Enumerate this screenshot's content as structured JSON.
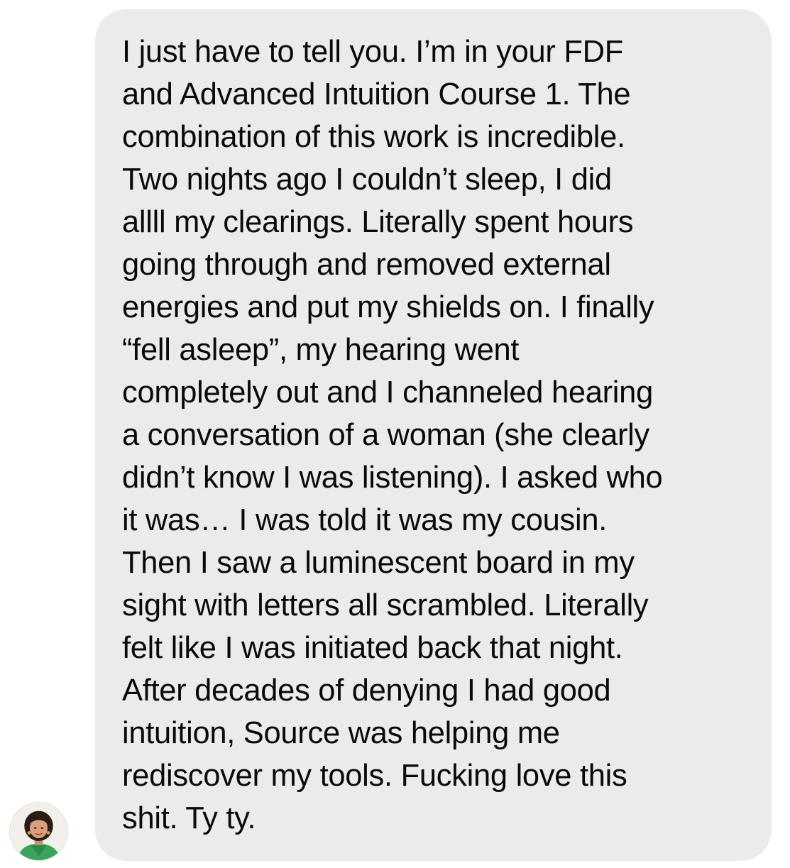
{
  "conversation": {
    "message": {
      "lines": [
        "I just have to tell you. I’m in your FDF",
        "and Advanced Intuition Course 1. The",
        "combination of this work is incredible.",
        "Two nights ago I couldn’t sleep, I did",
        "allll my clearings. Literally spent hours",
        "going through and removed external",
        "energies and put my shields on. I finally",
        "“fell asleep”, my hearing went",
        "completely out and I channeled hearing",
        "a conversation of a woman (she clearly",
        "didn’t know I was listening). I asked who",
        "it was… I was told it was my cousin.",
        "Then I saw a luminescent board in my",
        "sight with letters all scrambled. Literally",
        "felt like I was initiated back that night.",
        "After decades of denying I had good",
        "intuition, Source was helping me",
        "rediscover my tools. Fucking love this",
        "shit. Ty ty."
      ]
    },
    "sender": {
      "avatar_icon": "profile-photo-avatar"
    }
  },
  "colors": {
    "bubble_background": "#ebebeb",
    "text": "#0a0a0a",
    "page_background": "#ffffff"
  }
}
